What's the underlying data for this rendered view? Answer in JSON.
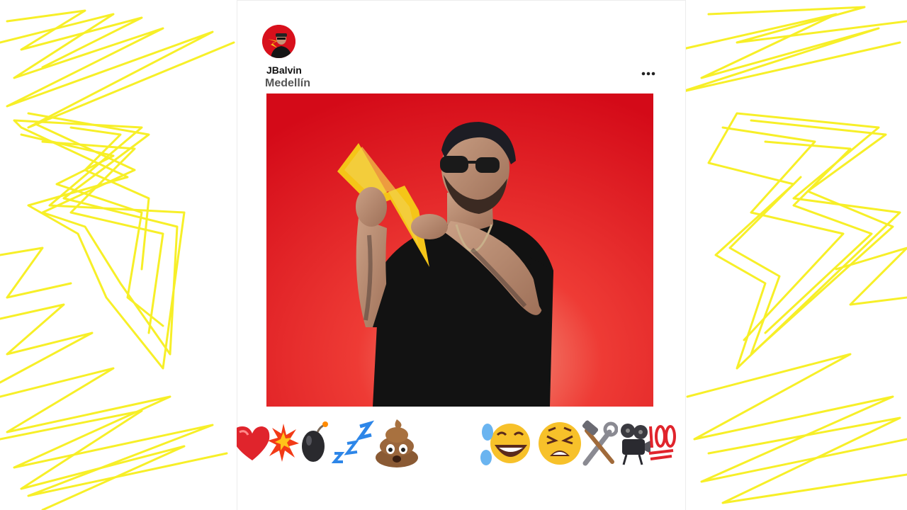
{
  "post": {
    "username": "JBalvin",
    "location": "Medellín",
    "avatar_icon": "jbalvin-avatar",
    "more_icon": "more-horizontal-icon"
  },
  "photo": {
    "description_icon": "jbalvin-lightning-photo",
    "background_color": "#d8101c"
  },
  "reaction_emojis": [
    "red-heart-emoji",
    "collision-emoji",
    "bomb-emoji",
    "sleeping-zzz-emoji",
    "pile-of-poo-emoji",
    "face-with-tears-of-joy-emoji",
    "tired-face-emoji",
    "hammer-and-wrench-emoji",
    "film-projector-emoji",
    "hundred-points-emoji"
  ],
  "colors": {
    "scribble_yellow": "#f7ef1d",
    "accent_red": "#d8101c",
    "lightning_yellow": "#f5c518"
  }
}
